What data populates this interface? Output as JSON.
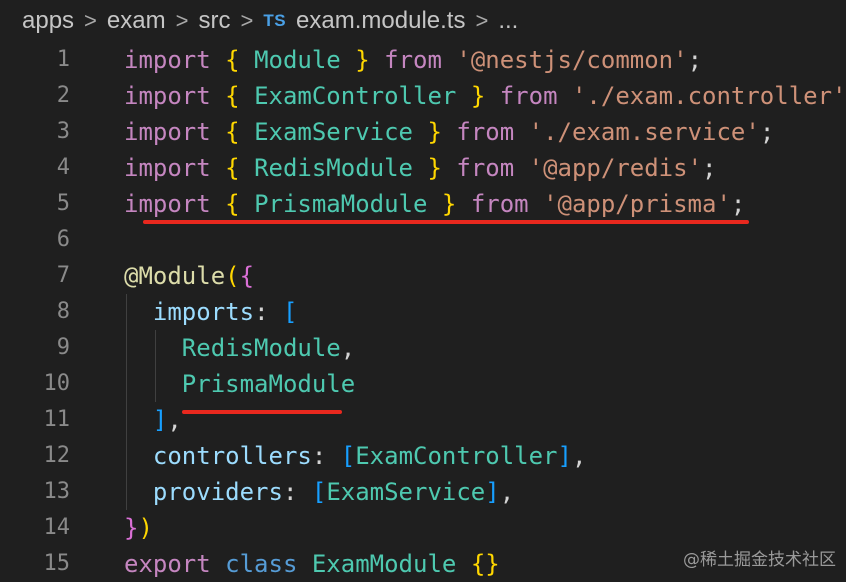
{
  "breadcrumb": {
    "items": [
      "apps",
      "exam",
      "src"
    ],
    "file_icon": "TS",
    "file": "exam.module.ts",
    "separator": ">",
    "more": "..."
  },
  "lines": [
    {
      "n": "1",
      "tokens": [
        [
          "kw",
          "import"
        ],
        [
          "p",
          " "
        ],
        [
          "b1",
          "{"
        ],
        [
          "p",
          " "
        ],
        [
          "id",
          "Module"
        ],
        [
          "p",
          " "
        ],
        [
          "b1",
          "}"
        ],
        [
          "p",
          " "
        ],
        [
          "kw",
          "from"
        ],
        [
          "p",
          " "
        ],
        [
          "str",
          "'@nestjs/common'"
        ],
        [
          "p",
          ";"
        ]
      ]
    },
    {
      "n": "2",
      "tokens": [
        [
          "kw",
          "import"
        ],
        [
          "p",
          " "
        ],
        [
          "b1",
          "{"
        ],
        [
          "p",
          " "
        ],
        [
          "id",
          "ExamController"
        ],
        [
          "p",
          " "
        ],
        [
          "b1",
          "}"
        ],
        [
          "p",
          " "
        ],
        [
          "kw",
          "from"
        ],
        [
          "p",
          " "
        ],
        [
          "str",
          "'./exam.controller'"
        ],
        [
          "p",
          ";"
        ]
      ]
    },
    {
      "n": "3",
      "tokens": [
        [
          "kw",
          "import"
        ],
        [
          "p",
          " "
        ],
        [
          "b1",
          "{"
        ],
        [
          "p",
          " "
        ],
        [
          "id",
          "ExamService"
        ],
        [
          "p",
          " "
        ],
        [
          "b1",
          "}"
        ],
        [
          "p",
          " "
        ],
        [
          "kw",
          "from"
        ],
        [
          "p",
          " "
        ],
        [
          "str",
          "'./exam.service'"
        ],
        [
          "p",
          ";"
        ]
      ]
    },
    {
      "n": "4",
      "tokens": [
        [
          "kw",
          "import"
        ],
        [
          "p",
          " "
        ],
        [
          "b1",
          "{"
        ],
        [
          "p",
          " "
        ],
        [
          "id",
          "RedisModule"
        ],
        [
          "p",
          " "
        ],
        [
          "b1",
          "}"
        ],
        [
          "p",
          " "
        ],
        [
          "kw",
          "from"
        ],
        [
          "p",
          " "
        ],
        [
          "str",
          "'@app/redis'"
        ],
        [
          "p",
          ";"
        ]
      ]
    },
    {
      "n": "5",
      "tokens": [
        [
          "kw",
          "import"
        ],
        [
          "p",
          " "
        ],
        [
          "b1",
          "{"
        ],
        [
          "p",
          " "
        ],
        [
          "id",
          "PrismaModule"
        ],
        [
          "p",
          " "
        ],
        [
          "b1",
          "}"
        ],
        [
          "p",
          " "
        ],
        [
          "kw",
          "from"
        ],
        [
          "p",
          " "
        ],
        [
          "str",
          "'@app/prisma'"
        ],
        [
          "p",
          ";"
        ]
      ]
    },
    {
      "n": "6",
      "tokens": []
    },
    {
      "n": "7",
      "tokens": [
        [
          "dec",
          "@Module"
        ],
        [
          "b1",
          "("
        ],
        [
          "b2",
          "{"
        ]
      ]
    },
    {
      "n": "8",
      "tokens": [
        [
          "p",
          "  "
        ],
        [
          "prop",
          "imports"
        ],
        [
          "p",
          ": "
        ],
        [
          "b3",
          "["
        ]
      ]
    },
    {
      "n": "9",
      "tokens": [
        [
          "p",
          "    "
        ],
        [
          "id",
          "RedisModule"
        ],
        [
          "p",
          ","
        ]
      ]
    },
    {
      "n": "10",
      "tokens": [
        [
          "p",
          "    "
        ],
        [
          "id",
          "PrismaModule"
        ]
      ]
    },
    {
      "n": "11",
      "tokens": [
        [
          "p",
          "  "
        ],
        [
          "b3",
          "]"
        ],
        [
          "p",
          ","
        ]
      ]
    },
    {
      "n": "12",
      "tokens": [
        [
          "p",
          "  "
        ],
        [
          "prop",
          "controllers"
        ],
        [
          "p",
          ": "
        ],
        [
          "b3",
          "["
        ],
        [
          "id",
          "ExamController"
        ],
        [
          "b3",
          "]"
        ],
        [
          "p",
          ","
        ]
      ]
    },
    {
      "n": "13",
      "tokens": [
        [
          "p",
          "  "
        ],
        [
          "prop",
          "providers"
        ],
        [
          "p",
          ": "
        ],
        [
          "b3",
          "["
        ],
        [
          "id",
          "ExamService"
        ],
        [
          "b3",
          "]"
        ],
        [
          "p",
          ","
        ]
      ]
    },
    {
      "n": "14",
      "tokens": [
        [
          "b2",
          "}"
        ],
        [
          "b1",
          ")"
        ]
      ]
    },
    {
      "n": "15",
      "tokens": [
        [
          "kw",
          "export"
        ],
        [
          "p",
          " "
        ],
        [
          "cls",
          "class"
        ],
        [
          "p",
          " "
        ],
        [
          "id",
          "ExamModule"
        ],
        [
          "p",
          " "
        ],
        [
          "b1",
          "{}"
        ]
      ]
    }
  ],
  "watermark": "@稀土掘金技术社区"
}
